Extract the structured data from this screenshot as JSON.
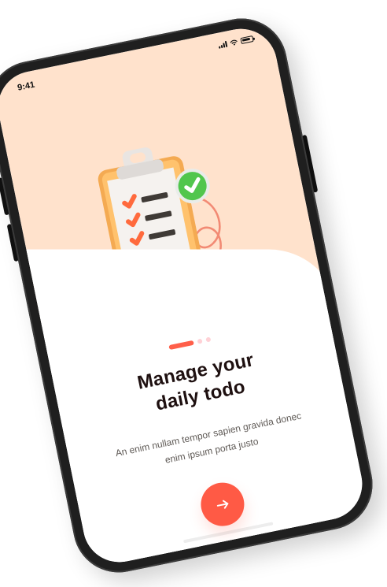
{
  "device": {
    "status_time": "9:41"
  },
  "onboarding": {
    "title_line1": "Manage your",
    "title_line2": "daily todo",
    "subtitle": "An enim nullam tempor sapien gravida donec enim ipsum porta justo",
    "pager": {
      "current_page": 1,
      "total_pages": 3
    },
    "next_button_icon": "arrow-right-icon"
  },
  "colors": {
    "accent": "#ff5a45",
    "peach_background": "#ffe2cc",
    "title_text": "#1e1010",
    "body_text": "#5f5a56"
  }
}
